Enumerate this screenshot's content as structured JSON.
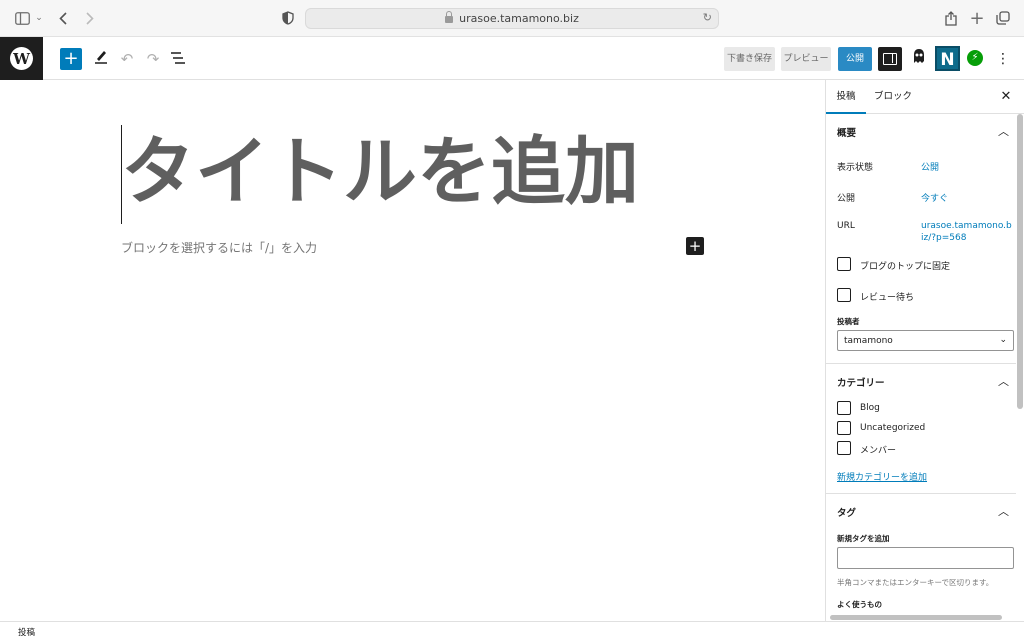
{
  "browser": {
    "url": "urasoe.tamamono.biz"
  },
  "toolbar": {
    "add_label": "+",
    "draft_label": "下書き保存",
    "preview_label": "プレビュー",
    "publish_label": "公開",
    "plugin_n_label": "N"
  },
  "editor": {
    "title": "タイトルを追加",
    "placeholder": "ブロックを選択するには「/」を入力",
    "inserter_label": "+"
  },
  "sidebar": {
    "tabs": [
      {
        "label": "投稿",
        "active": true
      },
      {
        "label": "ブロック",
        "active": false
      }
    ],
    "summary": {
      "heading": "概要",
      "visibility_label": "表示状態",
      "visibility_value": "公開",
      "publish_label": "公開",
      "publish_value": "今すぐ",
      "url_label": "URL",
      "url_value": "urasoe.tamamono.biz/?p=568",
      "sticky_label": "ブログのトップに固定",
      "sticky_checked": false,
      "review_label": "レビュー待ち",
      "review_checked": false,
      "author_label": "投稿者",
      "author_value": "tamamono"
    },
    "categories": {
      "heading": "カテゴリー",
      "items": [
        {
          "label": "Blog",
          "checked": false
        },
        {
          "label": "Uncategorized",
          "checked": false
        },
        {
          "label": "メンバー",
          "checked": false
        }
      ],
      "add_link": "新規カテゴリーを追加"
    },
    "tags": {
      "heading": "タグ",
      "new_tag_label": "新規タグを追加",
      "input_value": "",
      "help": "半角コンマまたはエンターキーで区切ります。",
      "frequent_label": "よく使うもの"
    }
  },
  "footer": {
    "breadcrumb": "投稿"
  },
  "colors": {
    "wp_blue": "#007cba",
    "publish_button": "#2a8ac4",
    "dark": "#1e1e1e",
    "jetpack_green": "#069e08"
  }
}
